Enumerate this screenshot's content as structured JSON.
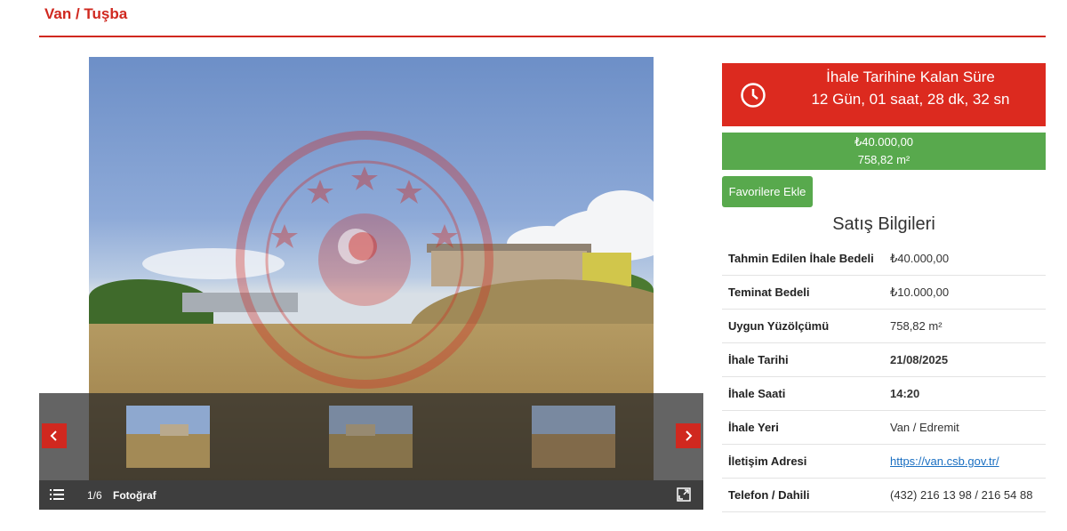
{
  "breadcrumb": "Van / Tuşba",
  "gallery": {
    "counter": "1/6",
    "label": "Fotoğraf",
    "thumbnails": [
      "thumb-1",
      "thumb-2",
      "thumb-3"
    ],
    "icons": {
      "prev": "chevron-left-icon",
      "next": "chevron-right-icon",
      "list": "list-icon",
      "expand": "expand-icon"
    }
  },
  "timer": {
    "title": "İhale Tarihine Kalan Süre",
    "value": "12 Gün, 01 saat, 28 dk, 32 sn",
    "icon": "clock-icon"
  },
  "price": {
    "amount": "₺40.000,00",
    "area": "758,82 m²"
  },
  "favorite_button": "Favorilere Ekle",
  "sales_title": "Satış Bilgileri",
  "sales_info": [
    {
      "key": "Tahmin Edilen İhale Bedeli",
      "value": "₺40.000,00"
    },
    {
      "key": "Teminat Bedeli",
      "value": "₺10.000,00"
    },
    {
      "key": "Uygun Yüzölçümü",
      "value": "758,82 m²"
    },
    {
      "key": "İhale Tarihi",
      "value": "21/08/2025"
    },
    {
      "key": "İhale Saati",
      "value": "14:20"
    },
    {
      "key": "İhale Yeri",
      "value": "Van / Edremit"
    },
    {
      "key": "İletişim Adresi",
      "value": "https://van.csb.gov.tr/"
    },
    {
      "key": "Telefon / Dahili",
      "value": "(432) 216 13 98 / 216 54 88"
    }
  ],
  "colors": {
    "brand_red": "#d0281f",
    "timer_red": "#dc2a1f",
    "success_green": "#58a94d",
    "link_blue": "#1a6fc2"
  }
}
